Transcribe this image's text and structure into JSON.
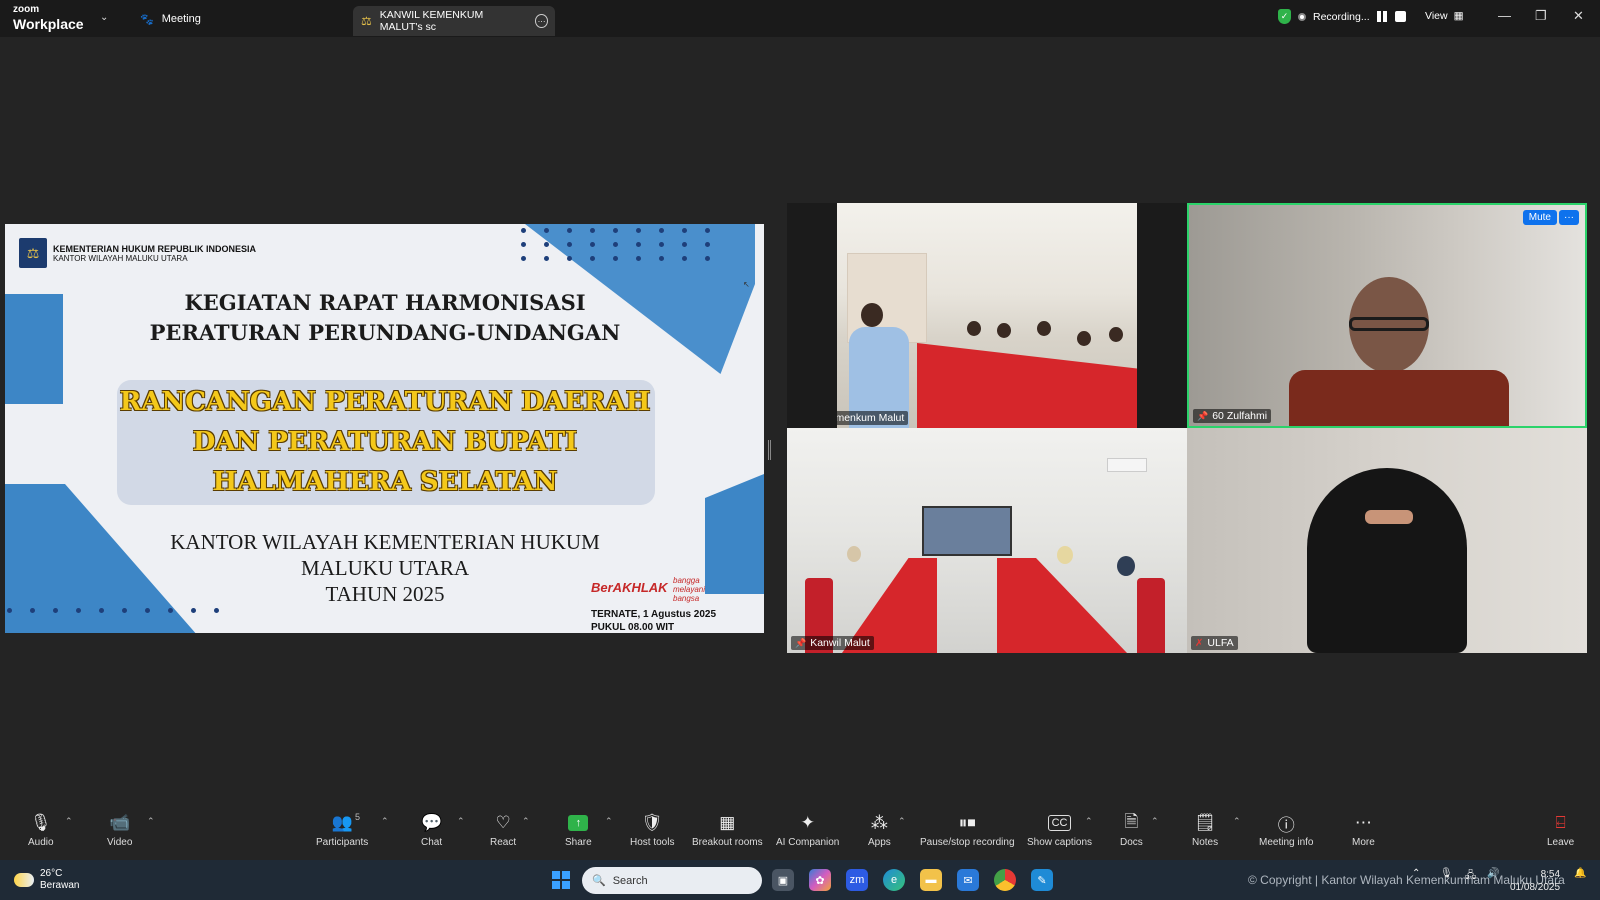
{
  "titlebar": {
    "brand_top": "zoom",
    "brand_bottom": "Workplace",
    "meeting_tab": "Meeting",
    "share_tab": "KANWIL KEMENKUM MALUT's sc",
    "recording": "Recording...",
    "view": "View"
  },
  "slide": {
    "org_line1": "KEMENTERIAN HUKUM REPUBLIK INDONESIA",
    "org_line2": "KANTOR WILAYAH MALUKU UTARA",
    "kegiatan_line1": "KEGIATAN RAPAT HARMONISASI",
    "kegiatan_line2": "PERATURAN PERUNDANG-UNDANGAN",
    "rancangan_line1": "RANCANGAN PERATURAN DAERAH",
    "rancangan_line2": "DAN PERATURAN BUPATI",
    "rancangan_line3": "HALMAHERA SELATAN",
    "kanwil_line1": "KANTOR WILAYAH KEMENTERIAN HUKUM",
    "kanwil_line2": "MALUKU UTARA",
    "kanwil_line3": "TAHUN 2025",
    "berakhlak": "BerAKHLAK",
    "bangga": "bangga melayani bangsa",
    "ternate": "TERNATE, 1 Agustus 2025",
    "pukul": "PUKUL 08.00 WIT"
  },
  "participants": [
    {
      "name": "Kemenkum Malut"
    },
    {
      "name": "60 Zulfahmi"
    },
    {
      "name": "Kanwil Malut"
    },
    {
      "name": "ULFA"
    }
  ],
  "tile_controls": {
    "mute": "Mute",
    "more": "···"
  },
  "toolbar": {
    "audio": "Audio",
    "video": "Video",
    "participants": "Participants",
    "participants_count": "5",
    "chat": "Chat",
    "react": "React",
    "share": "Share",
    "host_tools": "Host tools",
    "breakout_rooms": "Breakout rooms",
    "ai_companion": "AI Companion",
    "apps": "Apps",
    "pause_recording": "Pause/stop recording",
    "show_captions": "Show captions",
    "docs": "Docs",
    "notes": "Notes",
    "meeting_info": "Meeting info",
    "more": "More",
    "leave": "Leave"
  },
  "taskbar": {
    "temperature": "26°C",
    "weather": "Berawan",
    "search_placeholder": "Search",
    "copyright": "© Copyright | Kantor Wilayah Kemenkumham Maluku Utara",
    "time": "8:54",
    "date": "01/08/2025"
  }
}
